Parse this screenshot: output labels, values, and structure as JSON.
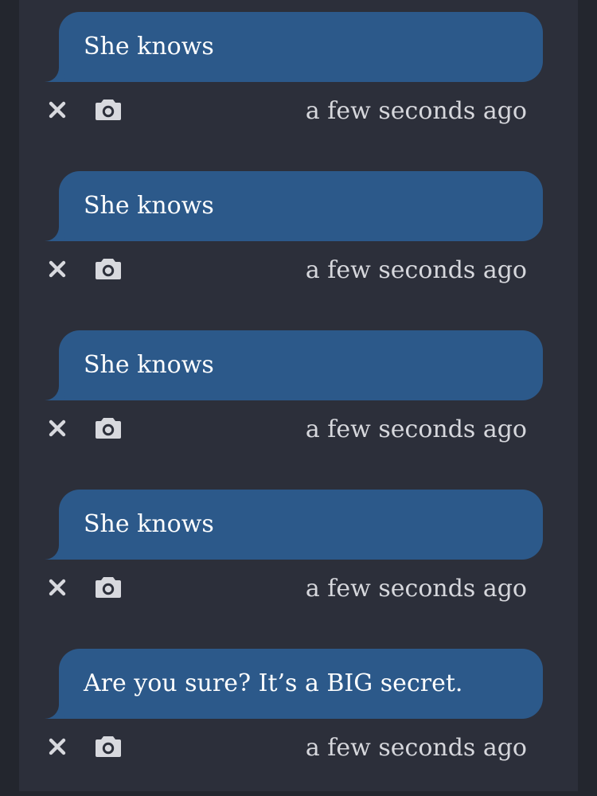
{
  "messages": [
    {
      "text": "She knows",
      "timestamp": "a few seconds ago"
    },
    {
      "text": "She knows",
      "timestamp": "a few seconds ago"
    },
    {
      "text": "She knows",
      "timestamp": "a few seconds ago"
    },
    {
      "text": "She knows",
      "timestamp": "a few seconds ago"
    },
    {
      "text": "Are you sure? It’s a BIG secret.",
      "timestamp": "a few seconds ago"
    }
  ],
  "icons": {
    "close": "close-icon",
    "camera": "camera-icon"
  },
  "colors": {
    "page_background": "#23262e",
    "panel_background": "#2c2f3a",
    "bubble": "#2c598a",
    "text": "#ffffff",
    "meta_text": "#d6d7dc"
  }
}
